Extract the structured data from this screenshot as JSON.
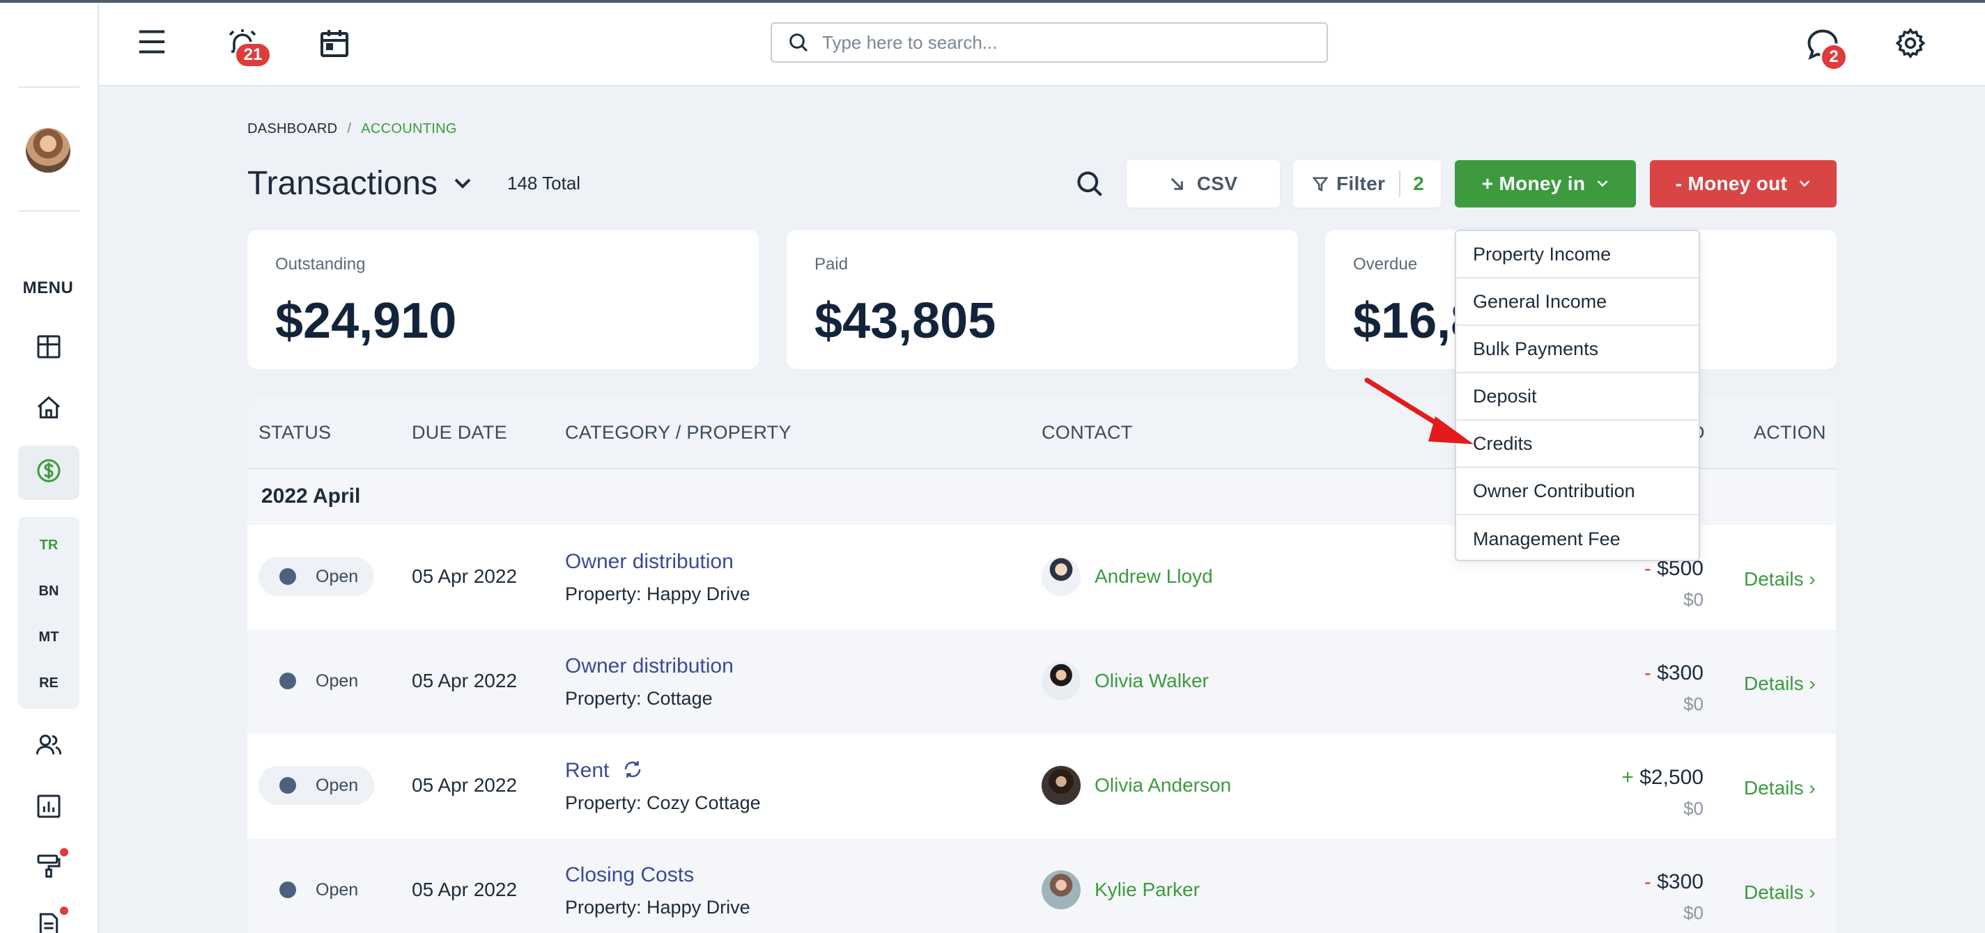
{
  "header": {
    "notifications_count": "21",
    "messages_count": "2",
    "search_placeholder": "Type here to search..."
  },
  "sidebar": {
    "menu_label": "MENU",
    "sub_items": [
      "TR",
      "BN",
      "MT",
      "RE"
    ]
  },
  "breadcrumb": {
    "root": "DASHBOARD",
    "sep": "/",
    "current": "ACCOUNTING"
  },
  "page": {
    "title": "Transactions",
    "total": "148 Total"
  },
  "toolbar": {
    "csv_label": "CSV",
    "filter_label": "Filter",
    "filter_count": "2",
    "money_in_label": "+ Money in",
    "money_out_label": "- Money out"
  },
  "cards": [
    {
      "label": "Outstanding",
      "value": "$24,910"
    },
    {
      "label": "Paid",
      "value": "$43,805"
    },
    {
      "label": "Overdue",
      "value": "$16,8"
    }
  ],
  "table": {
    "headers": {
      "status": "STATUS",
      "due_date": "DUE DATE",
      "category": "CATEGORY / PROPERTY",
      "contact": "CONTACT",
      "paid": "D",
      "action": "ACTION"
    },
    "group": "2022 April",
    "rows": [
      {
        "status": "Open",
        "due": "05 Apr 2022",
        "category": "Owner distribution",
        "property": "Property: Happy Drive",
        "contact": "Andrew Lloyd",
        "sign": "-",
        "amount": "$500",
        "paid": "$0",
        "action": "Details ›"
      },
      {
        "status": "Open",
        "due": "05 Apr 2022",
        "category": "Owner distribution",
        "property": "Property: Cottage",
        "contact": "Olivia Walker",
        "sign": "-",
        "amount": "$300",
        "paid": "$0",
        "action": "Details ›"
      },
      {
        "status": "Open",
        "due": "05 Apr 2022",
        "category": "Rent",
        "property": "Property: Cozy Cottage",
        "contact": "Olivia Anderson",
        "sign": "+",
        "amount": "$2,500",
        "paid": "$0",
        "action": "Details ›"
      },
      {
        "status": "Open",
        "due": "05 Apr 2022",
        "category": "Closing Costs",
        "property": "Property: Happy Drive",
        "contact": "Kylie Parker",
        "sign": "-",
        "amount": "$300",
        "paid": "$0",
        "action": "Details ›"
      }
    ]
  },
  "money_in_menu": [
    "Property Income",
    "General Income",
    "Bulk Payments",
    "Deposit",
    "Credits",
    "Owner Contribution",
    "Management Fee"
  ],
  "colors": {
    "accent_green": "#3d9a3f",
    "danger_red": "#d94545",
    "link_blue": "#3b4a9a"
  }
}
